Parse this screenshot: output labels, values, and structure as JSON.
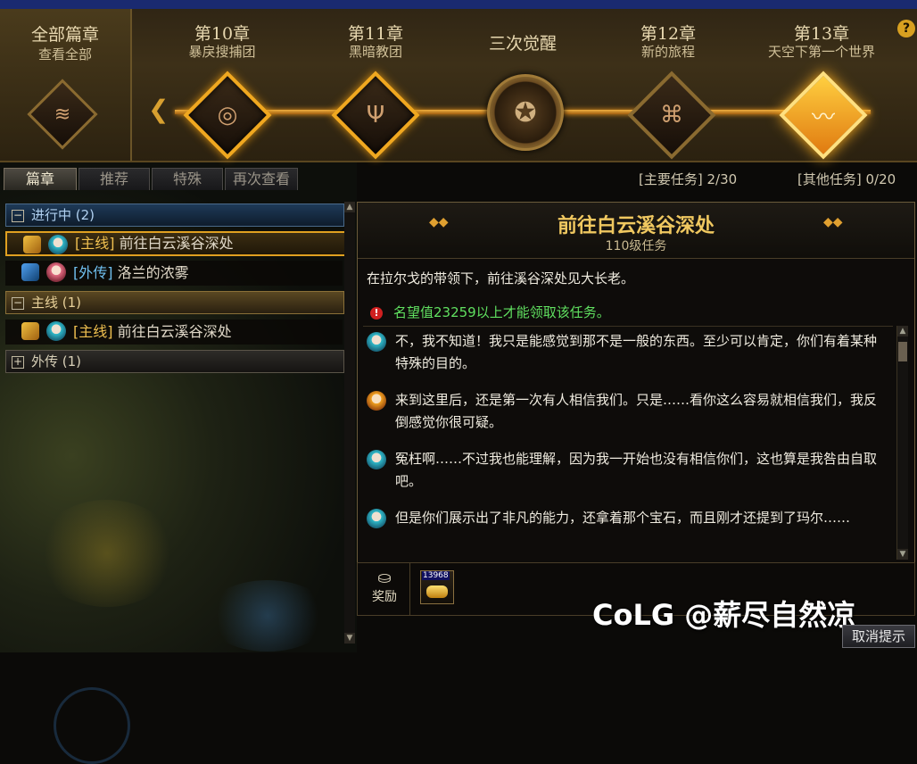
{
  "chapters": {
    "all": {
      "title": "全部篇章",
      "sub": "查看全部"
    },
    "items": [
      {
        "title": "第10章",
        "sub": "暴戾搜捕团",
        "icon": "shield-eye-icon",
        "state": "done"
      },
      {
        "title": "第11章",
        "sub": "黑暗教团",
        "icon": "trident-icon",
        "state": "done"
      },
      {
        "title": "三次觉醒",
        "sub": "",
        "icon": "awakening-gear-icon",
        "state": "milestone"
      },
      {
        "title": "第12章",
        "sub": "新的旅程",
        "icon": "knot-icon",
        "state": "dark"
      },
      {
        "title": "第13章",
        "sub": "天空下第一个世界",
        "icon": "zigzag-icon",
        "state": "current"
      }
    ],
    "help": "?"
  },
  "tabs": [
    {
      "label": "篇章",
      "active": true
    },
    {
      "label": "推荐",
      "active": false
    },
    {
      "label": "特殊",
      "active": false
    },
    {
      "label": "再次查看",
      "active": false
    }
  ],
  "counts": {
    "main": "[主要任务] 2/30",
    "other": "[其他任务] 0/20"
  },
  "quest_list": {
    "progress_group": {
      "sign": "−",
      "label": "进行中 (2)"
    },
    "progress_items": [
      {
        "tag": "[主线]",
        "name": "前往白云溪谷深处",
        "selected": true
      },
      {
        "tag": "[外传]",
        "name": "洛兰的浓雾",
        "selected": false
      }
    ],
    "main_group": {
      "sign": "−",
      "label": "主线 (1)"
    },
    "main_items": [
      {
        "tag": "[主线]",
        "name": "前往白云溪谷深处"
      }
    ],
    "side_group": {
      "sign": "+",
      "label": "外传 (1)"
    }
  },
  "detail": {
    "ornament": "◆◆",
    "title": "前往白云溪谷深处",
    "level": "110级任务",
    "description": "在拉尔戈的带领下，前往溪谷深处见大长老。",
    "warning_icon": "!",
    "warning": "名望值23259以上才能领取该任务。",
    "dialog": [
      {
        "speaker": "teal",
        "text": "不，我不知道！我只是能感觉到那不是一般的东西。至少可以肯定，你们有着某种特殊的目的。"
      },
      {
        "speaker": "girl",
        "text": "来到这里后，还是第一次有人相信我们。只是……看你这么容易就相信我们，我反倒感觉你很可疑。"
      },
      {
        "speaker": "teal",
        "text": "冤枉啊……不过我也能理解，因为我一开始也没有相信你们，这也算是我咎由自取吧。"
      },
      {
        "speaker": "teal",
        "text": "但是你们展示出了非凡的能力，还拿着那个宝石，而且刚才还提到了玛尔……"
      }
    ]
  },
  "reward": {
    "label": "奖励",
    "item_count": "13968"
  },
  "cancel_button": "取消提示",
  "watermark": "CoLG @薪尽自然凉",
  "colors": {
    "accent": "#f0a820",
    "title": "#f0c860",
    "warning": "#60e060"
  }
}
